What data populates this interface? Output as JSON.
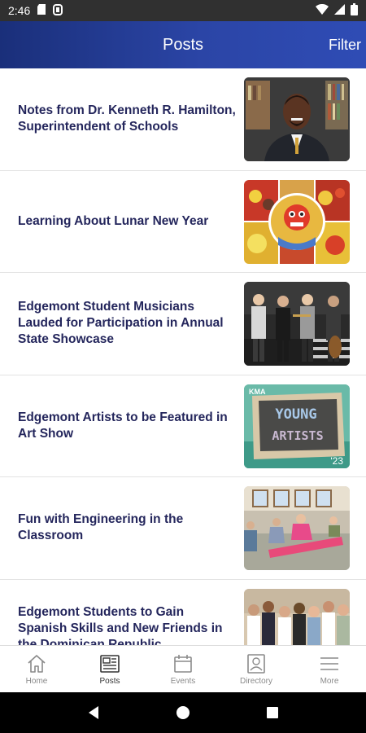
{
  "status_bar": {
    "time": "2:46"
  },
  "header": {
    "title": "Posts",
    "filter_label": "Filter"
  },
  "posts": [
    {
      "title": "Notes from Dr. Kenneth R. Hamilton, Superintendent of Schools"
    },
    {
      "title": "Learning About Lunar New Year"
    },
    {
      "title": "Edgemont Student Musicians Lauded for Participation in Annual State Showcase"
    },
    {
      "title": "Edgemont Artists to be Featured in Art Show"
    },
    {
      "title": "Fun with Engineering in the Classroom"
    },
    {
      "title": "Edgemont Students to Gain Spanish Skills and New Friends in the Dominican Republic"
    }
  ],
  "thumb_texts": {
    "kma": "KMA",
    "young": "YOUNG",
    "artists": "ARTISTS",
    "year": "'23"
  },
  "nav": {
    "items": [
      {
        "label": "Home",
        "icon": "home-icon"
      },
      {
        "label": "Posts",
        "icon": "newspaper-icon"
      },
      {
        "label": "Events",
        "icon": "calendar-icon"
      },
      {
        "label": "Directory",
        "icon": "contact-card-icon"
      },
      {
        "label": "More",
        "icon": "menu-icon"
      }
    ],
    "active": "Posts"
  },
  "colors": {
    "header_start": "#1a2f7a",
    "header_end": "#2f4cb5",
    "title_text": "#24265c"
  }
}
